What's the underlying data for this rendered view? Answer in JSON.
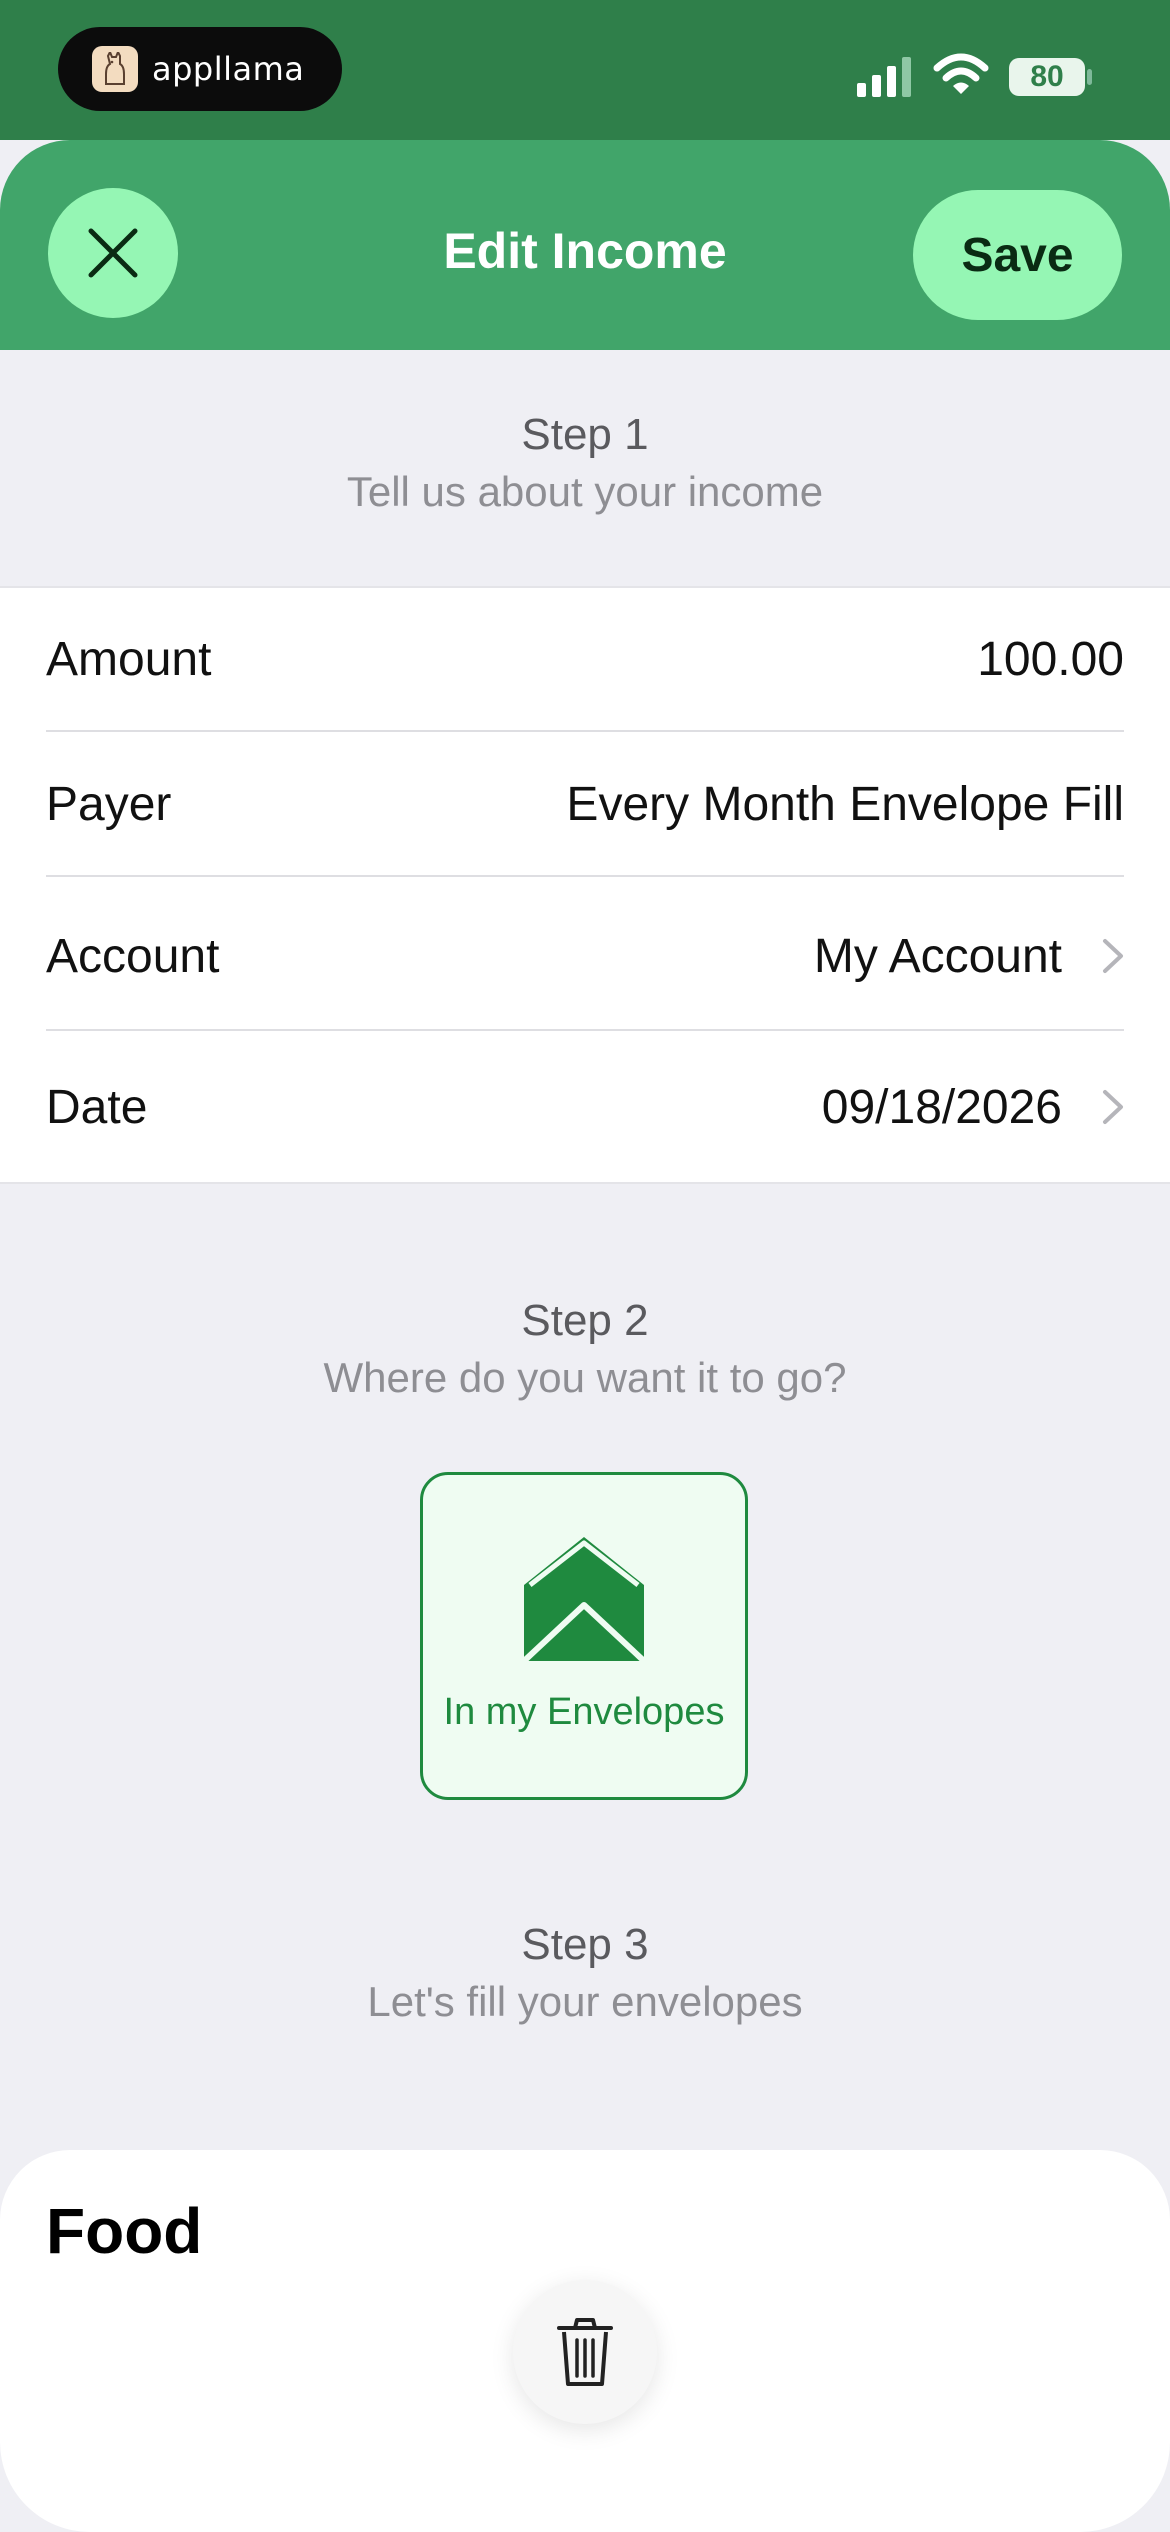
{
  "status_bar": {
    "app_brand": "appllama",
    "battery": "80"
  },
  "header": {
    "title": "Edit Income",
    "save_label": "Save"
  },
  "step1": {
    "heading": "Step 1",
    "subtitle": "Tell us about your income"
  },
  "form": {
    "rows": [
      {
        "label": "Amount",
        "value": "100.00"
      },
      {
        "label": "Payer",
        "value": "Every Month Envelope Fill"
      },
      {
        "label": "Account",
        "value": "My Account"
      },
      {
        "label": "Date",
        "value": "09/18/2026"
      }
    ]
  },
  "step2": {
    "heading": "Step 2",
    "subtitle": "Where do you want it to go?",
    "option_label": "In my Envelopes"
  },
  "step3": {
    "heading": "Step 3",
    "subtitle": "Let's fill your envelopes"
  },
  "category": {
    "heading": "Food"
  },
  "colors": {
    "header_green": "#41a56a",
    "status_green": "#2f7f4a",
    "button_mint": "#95f6b4",
    "envelope_green": "#1f8a3f"
  },
  "icons": [
    "close-icon",
    "envelope-open-icon",
    "chevron-right-icon",
    "trash-icon",
    "signal-icon",
    "wifi-icon",
    "battery-icon"
  ]
}
